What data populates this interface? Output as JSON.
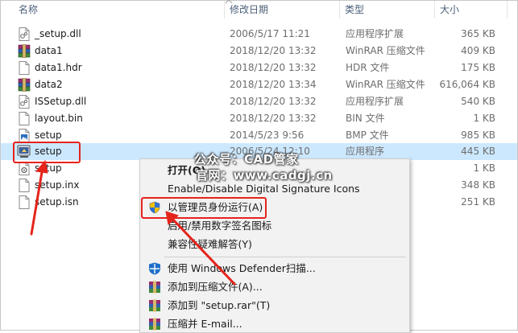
{
  "header": {
    "name": "名称",
    "date": "修改日期",
    "type": "类型",
    "size": "大小"
  },
  "files": [
    {
      "name": "_setup.dll",
      "date": "2006/5/17 11:21",
      "type": "应用程序扩展",
      "size": "365 KB",
      "icon": "dll-file-icon"
    },
    {
      "name": "data1",
      "date": "2018/12/20 13:32",
      "type": "WinRAR 压缩文件",
      "size": "409 KB",
      "icon": "winrar-archive-icon"
    },
    {
      "name": "data1.hdr",
      "date": "2018/12/20 13:32",
      "type": "HDR 文件",
      "size": "175 KB",
      "icon": "blank-file-icon"
    },
    {
      "name": "data2",
      "date": "2018/12/20 13:34",
      "type": "WinRAR 压缩文件",
      "size": "616,064 KB",
      "icon": "winrar-archive-icon"
    },
    {
      "name": "ISSetup.dll",
      "date": "2018/12/20 13:32",
      "type": "应用程序扩展",
      "size": "540 KB",
      "icon": "dll-file-icon"
    },
    {
      "name": "layout.bin",
      "date": "2018/12/20 13:32",
      "type": "BIN 文件",
      "size": "1 KB",
      "icon": "blank-file-icon"
    },
    {
      "name": "setup",
      "date": "2014/5/23 9:56",
      "type": "BMP 文件",
      "size": "985 KB",
      "icon": "bmp-file-icon"
    },
    {
      "name": "setup",
      "date": "2006/5/24 12:10",
      "type": "应用程序",
      "size": "445 KB",
      "icon": "setup-exe-icon"
    },
    {
      "name": "setup",
      "date": "",
      "type": "",
      "size": "1 KB",
      "icon": "ini-file-icon"
    },
    {
      "name": "setup.inx",
      "date": "",
      "type": "",
      "size": "348 KB",
      "icon": "blank-file-icon"
    },
    {
      "name": "setup.isn",
      "date": "",
      "type": "",
      "size": "251 KB",
      "icon": "blank-file-icon"
    }
  ],
  "context_menu": {
    "open": "打开(O)",
    "signature_icons": "Enable/Disable Digital Signature Icons",
    "run_as_admin": "以管理员身份运行(A)",
    "toggle_signature_cn": "启用/禁用数字签名图标",
    "compat_troubleshoot": "兼容性疑难解答(Y)",
    "defender_scan": "使用 Windows Defender扫描...",
    "add_to_archive": "添加到压缩文件(A)...",
    "add_to_setup_rar": "添加到 \"setup.rar\"(T)",
    "compress_email": "压缩并 E-mail..."
  },
  "watermark": {
    "line1": "公众号：CAD管家",
    "line2": "官网：www.cadgj.cn"
  },
  "colors": {
    "selection": "#cce8ff",
    "callout_red": "#e5241b",
    "header_text": "#4c607a",
    "menu_bg": "#f2f2f2"
  }
}
